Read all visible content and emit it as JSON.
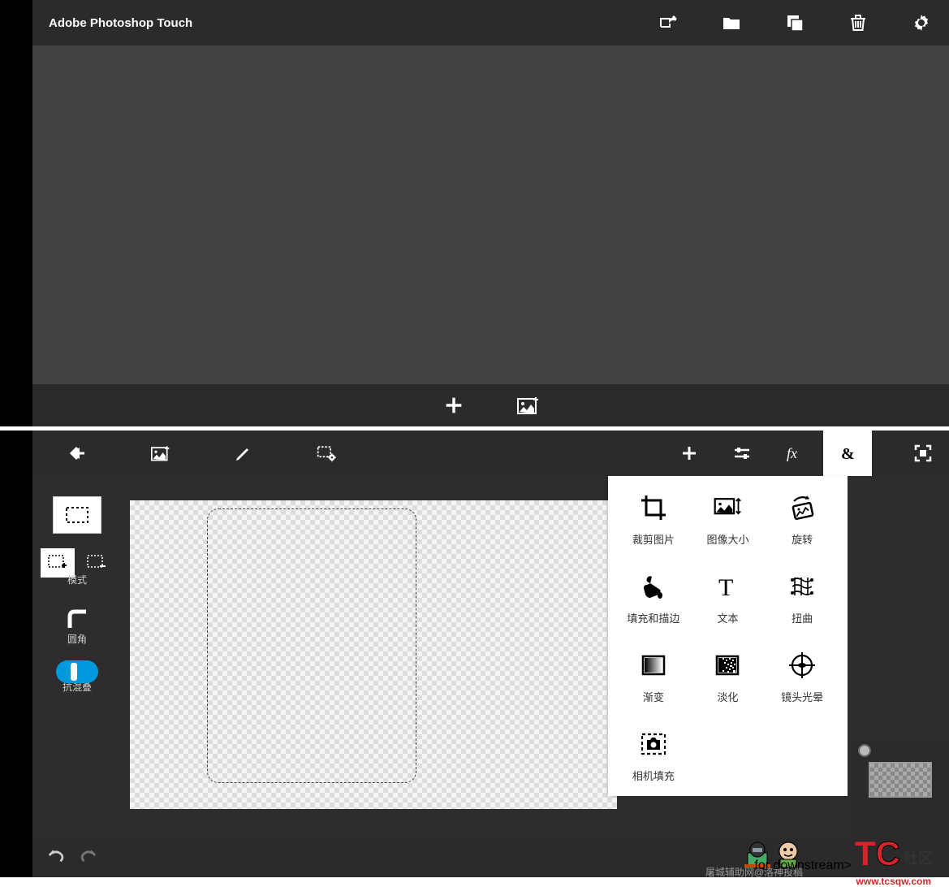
{
  "app_title": "Adobe Photoshop Touch",
  "top_toolbar": {
    "share": "share",
    "folder": "folder",
    "copy": "copy",
    "trash": "trash",
    "settings": "settings"
  },
  "top_bottom": {
    "add": "add",
    "image": "image-plus"
  },
  "editor_toolbar_left": {
    "back": "back",
    "image_add": "image-add",
    "edit": "edit",
    "selection": "selection-settings"
  },
  "editor_toolbar_right": {
    "add": "add",
    "sliders": "sliders",
    "fx": "fx",
    "more": "&",
    "fullscreen": "fullscreen"
  },
  "left_panel": {
    "mode_label": "模式",
    "corner_label": "圆角",
    "antialias_label": "抗混叠"
  },
  "menu": {
    "items": [
      {
        "id": "crop",
        "label": "裁剪图片"
      },
      {
        "id": "imagesize",
        "label": "图像大小"
      },
      {
        "id": "rotate",
        "label": "旋转"
      },
      {
        "id": "fillstroke",
        "label": "填充和描边"
      },
      {
        "id": "text",
        "label": "文本"
      },
      {
        "id": "warp",
        "label": "扭曲"
      },
      {
        "id": "gradient",
        "label": "渐变"
      },
      {
        "id": "fade",
        "label": "淡化"
      },
      {
        "id": "lensflare",
        "label": "镜头光晕"
      },
      {
        "id": "camerafill",
        "label": "相机填充"
      }
    ]
  },
  "footer_credit": "屠城辅助网@洛神投稿",
  "watermark": {
    "tc": "TC",
    "suffix": "社区",
    "url": "www.tcsqw.com"
  }
}
